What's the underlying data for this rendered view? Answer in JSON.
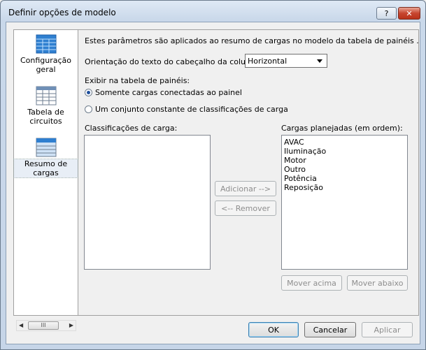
{
  "window": {
    "title": "Definir opções de modelo",
    "help_label": "?",
    "close_label": "✕"
  },
  "sidebar": {
    "items": [
      {
        "label": "Configuração geral",
        "icon": "general-config-icon"
      },
      {
        "label": "Tabela de circuitos",
        "icon": "circuit-table-icon"
      },
      {
        "label": "Resumo de cargas",
        "icon": "load-summary-icon",
        "selected": true
      }
    ],
    "scroll_thumb_label": "III"
  },
  "main": {
    "intro": "Estes parâmetros são aplicados ao resumo de cargas no modelo da tabela de painéis .",
    "orientation_label": "Orientação do texto do cabeçalho da coluna:",
    "orientation_value": "Horizontal",
    "display_label": "Exibir na tabela de painéis:",
    "radio_connected": "Somente cargas conectadas ao painel",
    "radio_constant": "Um conjunto constante de classificações de carga",
    "classifications_label": "Classificações de carga:",
    "planned_label": "Cargas planejadas (em ordem):",
    "planned_items": [
      "AVAC",
      "Iluminação",
      "Motor",
      "Outro",
      "Potência",
      "Reposição"
    ],
    "add_button": "Adicionar -->",
    "remove_button": "<-- Remover",
    "move_up_button": "Mover acima",
    "move_down_button": "Mover abaixo"
  },
  "footer": {
    "ok": "OK",
    "cancel": "Cancelar",
    "apply": "Aplicar"
  },
  "colors": {
    "selected_radio": "#1e4f9c",
    "icon_blue": "#2f7fd0"
  }
}
